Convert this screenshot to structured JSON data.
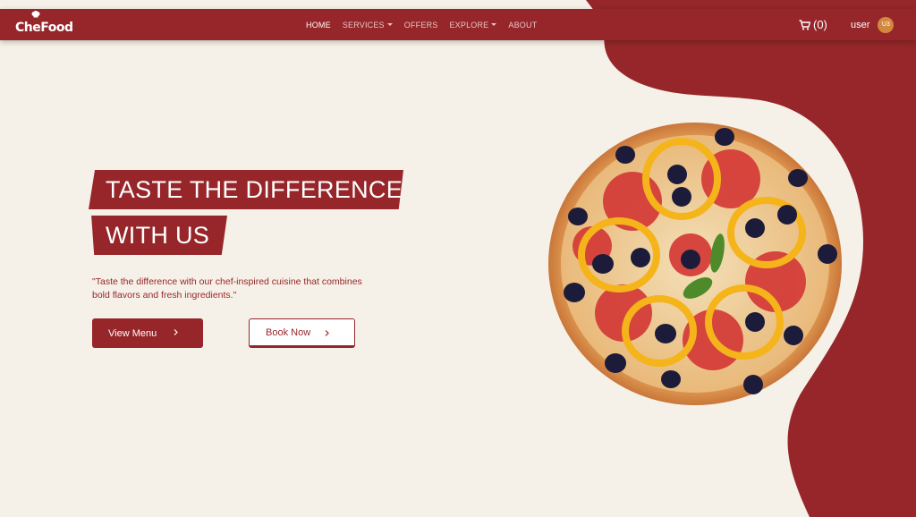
{
  "brand": {
    "name": "CheFood"
  },
  "nav": {
    "items": [
      {
        "label": "HOME",
        "active": true,
        "dropdown": false
      },
      {
        "label": "SERVICES",
        "active": false,
        "dropdown": true
      },
      {
        "label": "OFFERS",
        "active": false,
        "dropdown": false
      },
      {
        "label": "EXPLORE",
        "active": false,
        "dropdown": true
      },
      {
        "label": "ABOUT",
        "active": false,
        "dropdown": false
      }
    ]
  },
  "cart": {
    "label": "(0)",
    "icon": "cart-icon"
  },
  "user": {
    "name": "user",
    "initials": "U3"
  },
  "hero": {
    "headline_line1": "TASTE THE DIFFERENCE",
    "headline_line2": "WITH US",
    "tagline": "\"Taste the difference with our chef-inspired cuisine that combines bold flavors and fresh ingredients.\"",
    "primary_button": "View Menu",
    "secondary_button": "Book Now",
    "image": "pizza-image"
  },
  "colors": {
    "brand": "#96262a",
    "background": "#f6f1e8",
    "avatar": "#d2893e"
  }
}
